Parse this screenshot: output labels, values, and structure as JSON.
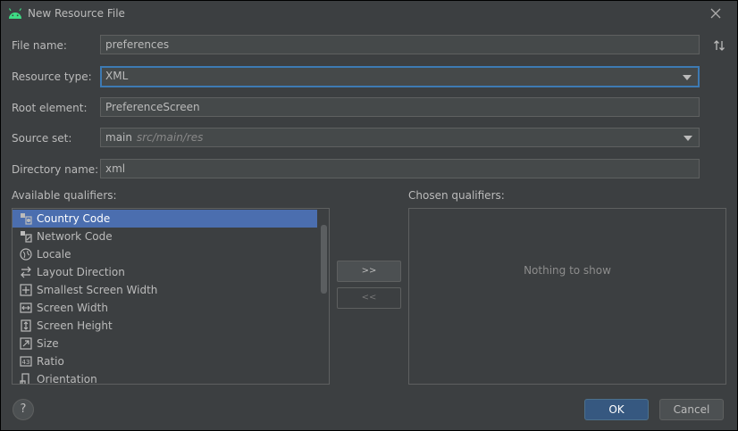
{
  "window": {
    "title": "New Resource File"
  },
  "form": {
    "file_name": {
      "label": "File name:",
      "value": "preferences"
    },
    "resource_type": {
      "label": "Resource type:",
      "value": "XML"
    },
    "root_element": {
      "label": "Root element:",
      "value": "PreferenceScreen"
    },
    "source_set": {
      "label": "Source set:",
      "value": "main",
      "hint": "src/main/res"
    },
    "directory_name": {
      "label": "Directory name:",
      "value": "xml"
    }
  },
  "qualifiers": {
    "available_label": "Available qualifiers:",
    "chosen_label": "Chosen qualifiers:",
    "chosen_empty_text": "Nothing to show",
    "add_button": ">>",
    "remove_button": "<<",
    "items": [
      {
        "label": "Country Code",
        "icon": "country-code-icon",
        "selected": true
      },
      {
        "label": "Network Code",
        "icon": "network-code-icon",
        "selected": false
      },
      {
        "label": "Locale",
        "icon": "globe-icon",
        "selected": false
      },
      {
        "label": "Layout Direction",
        "icon": "layout-direction-icon",
        "selected": false
      },
      {
        "label": "Smallest Screen Width",
        "icon": "smallest-width-icon",
        "selected": false
      },
      {
        "label": "Screen Width",
        "icon": "screen-width-icon",
        "selected": false
      },
      {
        "label": "Screen Height",
        "icon": "screen-height-icon",
        "selected": false
      },
      {
        "label": "Size",
        "icon": "size-icon",
        "selected": false
      },
      {
        "label": "Ratio",
        "icon": "ratio-icon",
        "selected": false
      },
      {
        "label": "Orientation",
        "icon": "orientation-icon",
        "selected": false
      }
    ]
  },
  "footer": {
    "help": "?",
    "ok": "OK",
    "cancel": "Cancel"
  },
  "colors": {
    "background": "#3c3f41",
    "field_background": "#45494a",
    "focus_border": "#3d7ab3",
    "selection": "#4b6eaf",
    "ok_button": "#365880"
  }
}
